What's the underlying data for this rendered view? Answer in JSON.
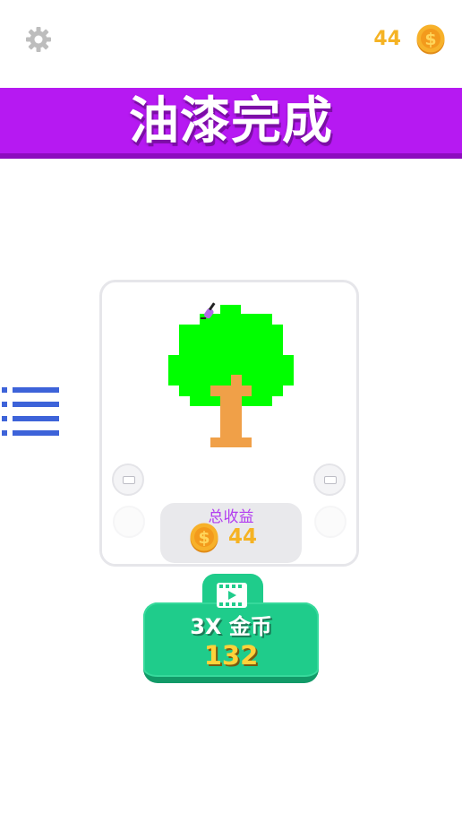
{
  "header": {
    "coin_count": "44",
    "icons": {
      "settings": "gear-icon",
      "coin": "coin-icon"
    }
  },
  "banner": {
    "title": "油漆完成",
    "color": "#b619f2"
  },
  "canvas": {
    "picture": "pixel-art-tree",
    "colors": {
      "foliage": "#00ff00",
      "trunk": "#f0a048",
      "brush": "#b06ae8"
    }
  },
  "earnings": {
    "label": "总收益",
    "amount": "44"
  },
  "reward_button": {
    "label": "3X 金币",
    "amount": "132",
    "icon": "video-icon",
    "color": "#1fcc8b"
  },
  "menu": {
    "icon": "list-icon",
    "color": "#3d63d9"
  }
}
